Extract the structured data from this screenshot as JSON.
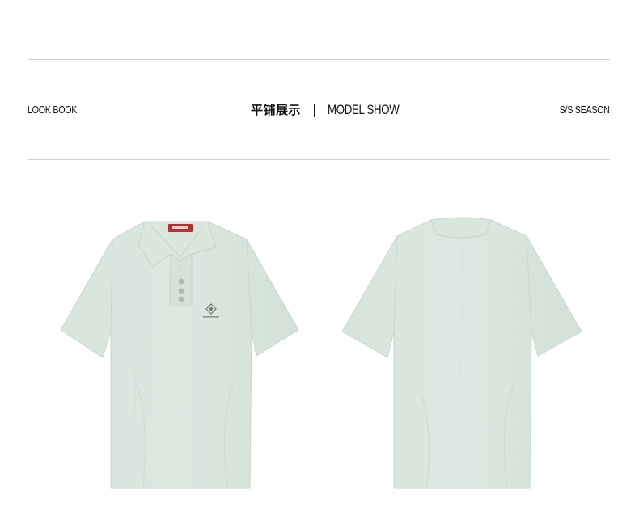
{
  "header": {
    "left_label": "LOOK BOOK",
    "title_cn": "平铺展示",
    "title_separator": "|",
    "title_en": "MODEL SHOW",
    "right_label": "S/S SEASON"
  },
  "products": [
    {
      "view": "front",
      "color": "#d5e3db"
    },
    {
      "view": "back",
      "color": "#d5e3db"
    }
  ],
  "colors": {
    "shirt": "#d5e3db",
    "shirt_shadow": "#c3d4ca",
    "rule": "#cfcfcf",
    "tag": "#b5302f"
  }
}
